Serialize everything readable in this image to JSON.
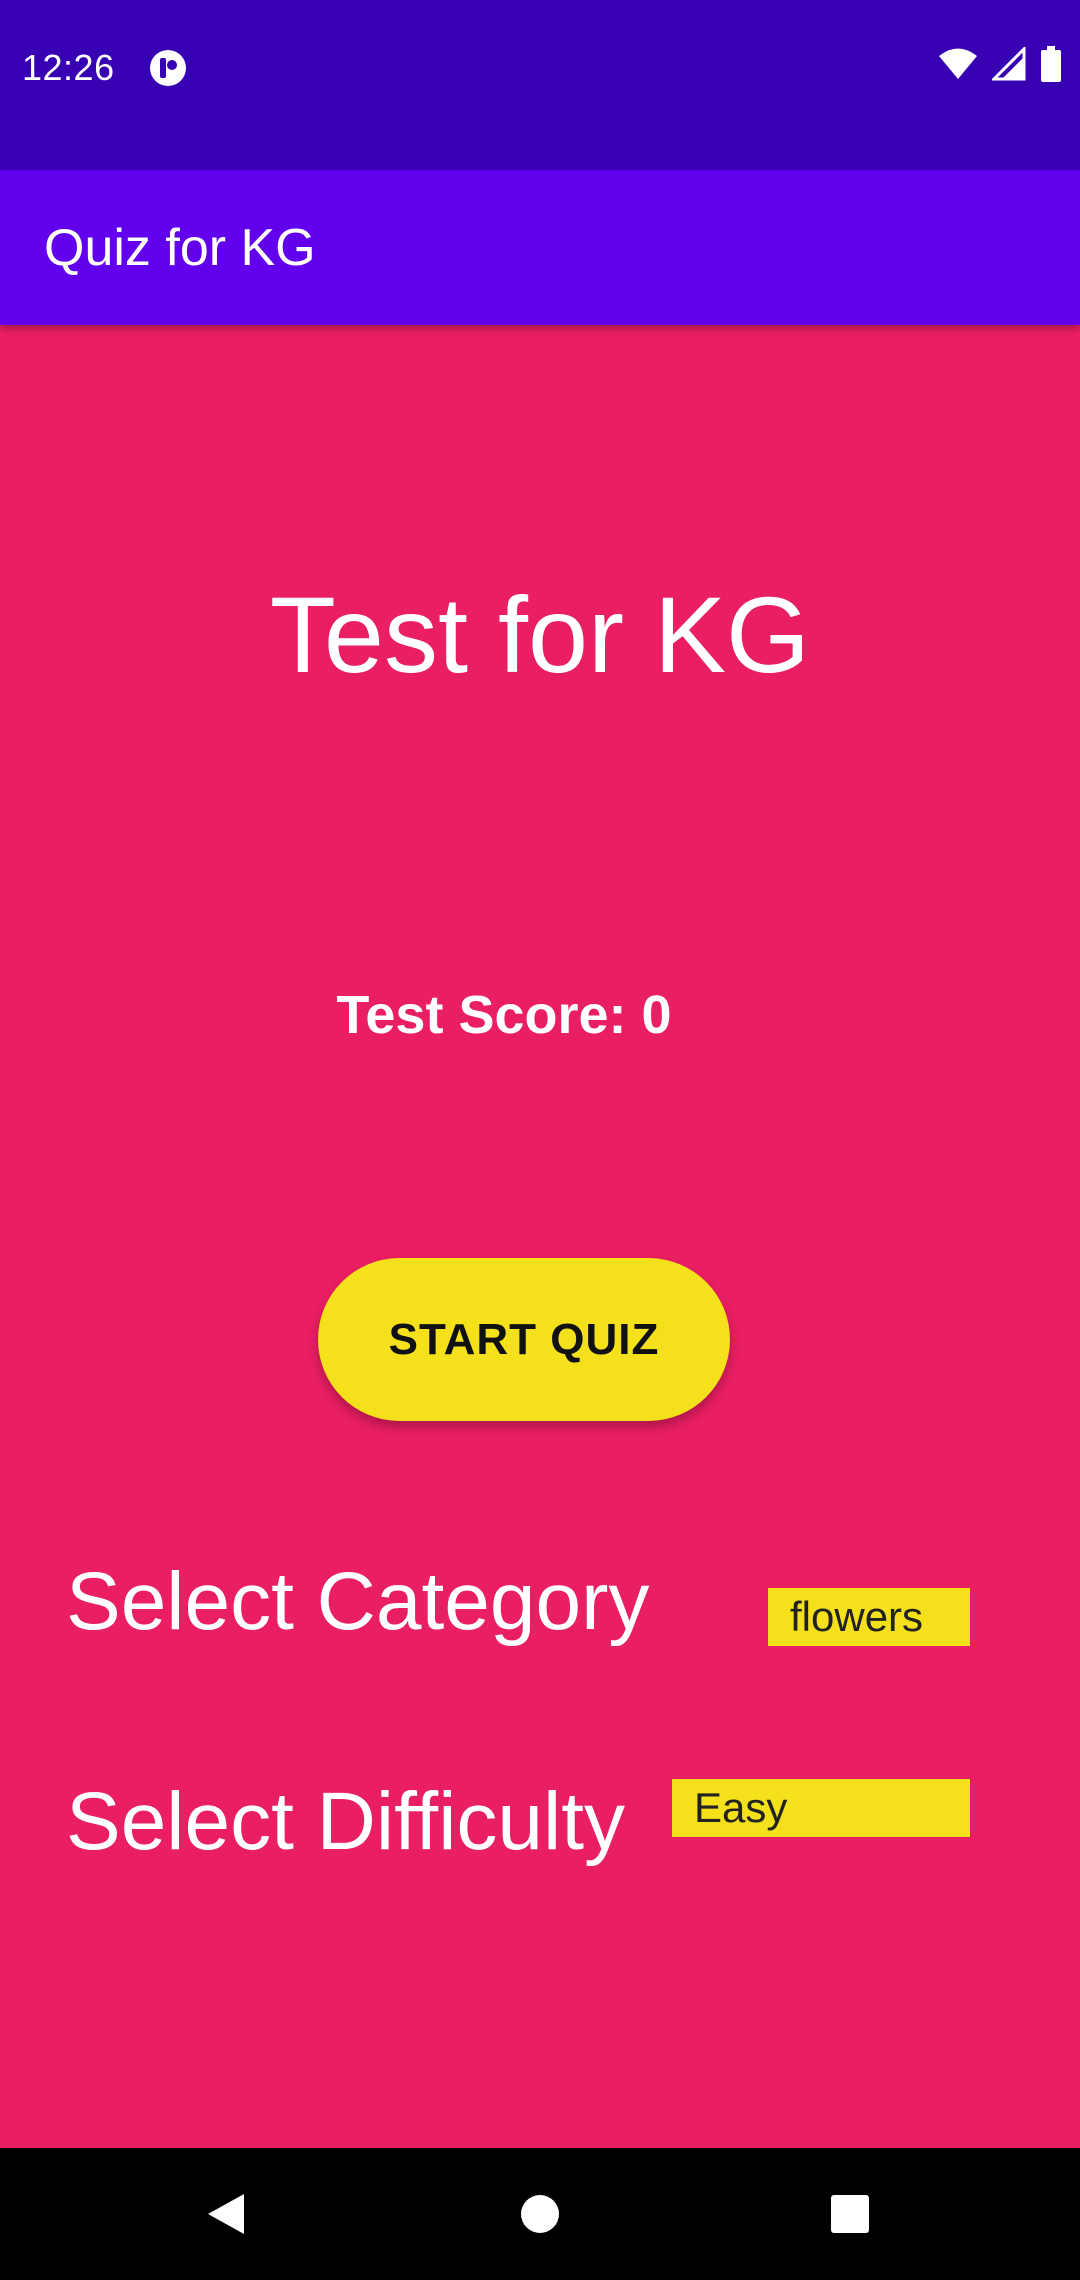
{
  "status_bar": {
    "time": "12:26",
    "icons": [
      "app-notification-icon",
      "wifi-icon",
      "cell-signal-icon",
      "battery-icon"
    ]
  },
  "app_bar": {
    "title": "Quiz for KG"
  },
  "main": {
    "heading": "Test for KG",
    "score_text": "Test Score: 0",
    "start_button_label": "START QUIZ",
    "category_label": "Select Category",
    "category_value": "flowers",
    "difficulty_label": "Select Difficulty",
    "difficulty_value": "Easy"
  },
  "nav_bar": {
    "icons": [
      "back-icon",
      "home-icon",
      "recents-icon"
    ]
  },
  "colors": {
    "status_bar": "#3700B3",
    "app_bar": "#6200EE",
    "background": "#E91E63",
    "accent_yellow": "#F4E11C"
  }
}
